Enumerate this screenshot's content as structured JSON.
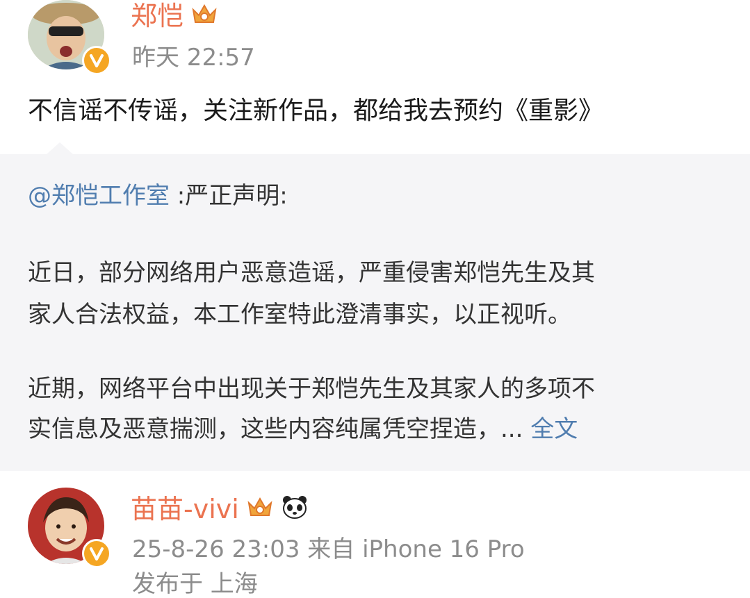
{
  "post": {
    "author_name": "郑恺",
    "time": "昨天 22:57",
    "text": "不信谣不传谣，关注新作品，都给我去预约《重影》",
    "author_badge_icon": "crown-icon",
    "verified_icon": "verified-v-icon"
  },
  "repost": {
    "mention": "@郑恺工作室",
    "title_rest": " :严正声明:",
    "para1_line1": "近日，部分网络用户恶意造谣，严重侵害郑恺先生及其",
    "para1_line2": "家人合法权益，本工作室特此澄清事实，以正视听。",
    "para2_line1": "近期，网络平台中出现关于郑恺先生及其家人的多项不",
    "para2_line2_text": "实信息及恶意揣测，这些内容纯属凭空捏造，... ",
    "full_text_link": "全文"
  },
  "comment": {
    "author_name": "苗苗-vivi",
    "meta_line1": "25-8-26 23:03  来自 iPhone 16 Pro",
    "meta_line2": "发布于 上海",
    "badges": [
      "crown-icon",
      "panda-icon"
    ]
  },
  "colors": {
    "name": "#eb7350",
    "link": "#507daf",
    "meta": "#8c8c8c",
    "repost_bg": "#f5f5f7",
    "verified": "#f5a623"
  }
}
